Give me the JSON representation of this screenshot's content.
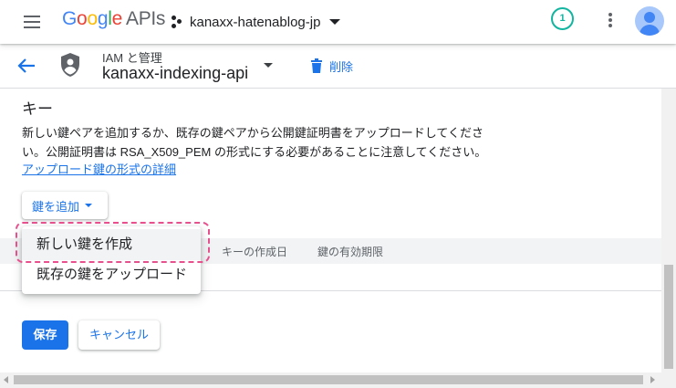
{
  "colors": {
    "accent": "#1a73e8",
    "badge": "#12b5a0",
    "highlight": "#e8508d"
  },
  "topbar": {
    "menu_icon": "hamburger-menu-icon",
    "logo_google": [
      "G",
      "o",
      "o",
      "g",
      "l",
      "e"
    ],
    "logo_apis": "APIs",
    "project_name": "kanaxx-hatenablog-jp",
    "notification_count": "1",
    "more_icon": "more-vert-icon",
    "avatar_icon": "account-avatar-icon"
  },
  "subheader": {
    "back_icon": "arrow-back-icon",
    "breadcrumb": "IAM と管理",
    "service_account": "kanaxx-indexing-api",
    "delete_label": "削除"
  },
  "keys": {
    "title": "キー",
    "description": "新しい鍵ペアを追加するか、既存の鍵ペアから公開鍵証明書をアップロードしてください。公開証明書は RSA_X509_PEM の形式にする必要があることに注意してください。",
    "link": "アップロード鍵の形式の詳細",
    "add_key_label": "鍵を追加",
    "columns": [
      "キーの作成日",
      "鍵の有効期限"
    ]
  },
  "menu": {
    "items": [
      "新しい鍵を作成",
      "既存の鍵をアップロード"
    ]
  },
  "actions": {
    "save": "保存",
    "cancel": "キャンセル"
  }
}
